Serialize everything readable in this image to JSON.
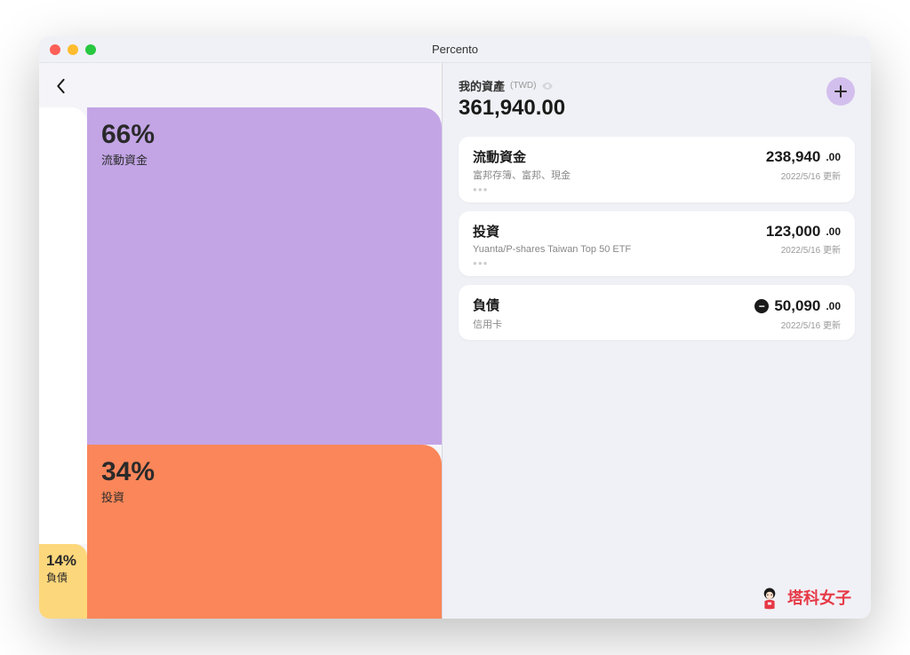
{
  "window": {
    "title": "Percento"
  },
  "treemap": {
    "liquid": {
      "pct": "66%",
      "name": "流動資金"
    },
    "invest": {
      "pct": "34%",
      "name": "投資"
    },
    "debt": {
      "pct": "14%",
      "name": "負債"
    }
  },
  "assets": {
    "heading": "我的資產",
    "currency": "(TWD)",
    "total": "361,940.00"
  },
  "categories": [
    {
      "title": "流動資金",
      "subtitle": "富邦存簿、富邦、現金",
      "amount_int": "238,940",
      "amount_dec": ".00",
      "updated": "2022/5/16 更新",
      "negative": false
    },
    {
      "title": "投資",
      "subtitle": "Yuanta/P-shares Taiwan Top 50 ETF",
      "amount_int": "123,000",
      "amount_dec": ".00",
      "updated": "2022/5/16 更新",
      "negative": false
    },
    {
      "title": "負債",
      "subtitle": "信用卡",
      "amount_int": "50,090",
      "amount_dec": ".00",
      "updated": "2022/5/16 更新",
      "negative": true
    }
  ],
  "watermark": {
    "text": "塔科女子"
  },
  "chart_data": {
    "type": "treemap",
    "title": "Asset Allocation",
    "series": [
      {
        "name": "流動資金",
        "value": 66,
        "color": "#c3a5e6"
      },
      {
        "name": "投資",
        "value": 34,
        "color": "#fa8659"
      },
      {
        "name": "負債",
        "value": 14,
        "color": "#fdd77b"
      }
    ],
    "unit": "%"
  }
}
